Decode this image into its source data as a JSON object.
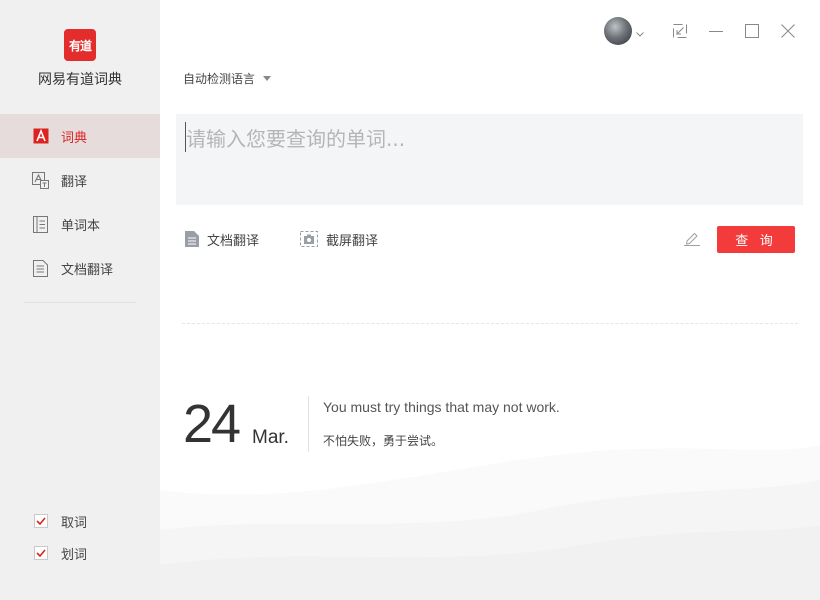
{
  "sidebar": {
    "logo_text": "有道",
    "app_name": "网易有道词典",
    "nav": [
      {
        "label": "词典",
        "icon": "dictionary-icon",
        "active": true
      },
      {
        "label": "翻译",
        "icon": "translate-icon",
        "active": false
      },
      {
        "label": "单词本",
        "icon": "wordbook-icon",
        "active": false
      },
      {
        "label": "文档翻译",
        "icon": "document-icon",
        "active": false
      }
    ],
    "options": [
      {
        "label": "取词",
        "checked": true
      },
      {
        "label": "划词",
        "checked": true
      }
    ]
  },
  "header": {
    "avatar": "user-avatar",
    "controls": [
      "shrink-icon",
      "minimize-icon",
      "maximize-icon",
      "close-icon"
    ]
  },
  "main": {
    "language": "自动检测语言",
    "input_placeholder": "请输入您要查询的单词...",
    "input_value": "",
    "tools": [
      {
        "label": "文档翻译",
        "icon": "document-translate-icon"
      },
      {
        "label": "截屏翻译",
        "icon": "screenshot-translate-icon"
      }
    ],
    "query_label": "查 询",
    "daily": {
      "day": "24",
      "month": "Mar.",
      "quote_en": "You must try things that may not work.",
      "quote_cn": "不怕失败，勇于尝试。"
    }
  },
  "colors": {
    "accent": "#f33b3b",
    "sidebar_bg": "#f0f0f0",
    "active_bg": "#e7dcdc",
    "input_bg": "#f4f5f7"
  }
}
